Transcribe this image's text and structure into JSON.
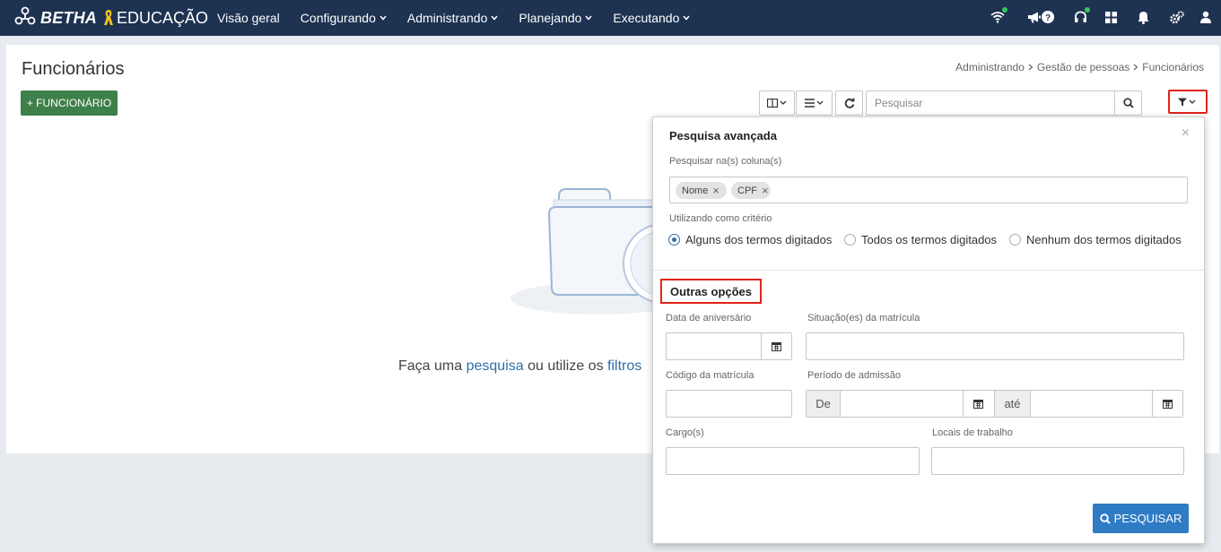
{
  "topbar": {
    "brand_name": "BETHA",
    "product_name": "EDUCAÇÃO",
    "nav": [
      {
        "label": "Visão geral"
      },
      {
        "label": "Configurando"
      },
      {
        "label": "Administrando"
      },
      {
        "label": "Planejando"
      },
      {
        "label": "Executando"
      }
    ],
    "icons": [
      "wifi-icon",
      "megaphone-icon",
      "help-icon",
      "headset-icon",
      "apps-grid-icon",
      "bell-icon",
      "settings-icon",
      "user-icon"
    ],
    "colors": {
      "background": "#1e3251",
      "status_dot": "#34c759"
    }
  },
  "page": {
    "title": "Funcionários",
    "breadcrumb": [
      "Administrando",
      "Gestão de pessoas",
      "Funcionários"
    ],
    "add_button": "+ FUNCIONÁRIO",
    "search_placeholder": "Pesquisar",
    "empty": {
      "prefix": "Faça uma ",
      "link1": "pesquisa",
      "middle": " ou utilize os ",
      "link2": "filtros"
    },
    "colors": {
      "add_button": "#3e8049",
      "link": "#2f6ea8",
      "highlight": "#e2231a"
    }
  },
  "advanced_search": {
    "title": "Pesquisa avançada",
    "columns_label": "Pesquisar na(s) coluna(s)",
    "columns": [
      {
        "label": "Nome"
      },
      {
        "label": "CPF"
      }
    ],
    "criteria_label": "Utilizando como critério",
    "criteria": [
      {
        "label": "Alguns dos termos digitados",
        "selected": true
      },
      {
        "label": "Todos os termos digitados",
        "selected": false
      },
      {
        "label": "Nenhum dos termos digitados",
        "selected": false
      }
    ],
    "other_options_title": "Outras opções",
    "fields": {
      "birthday": {
        "label": "Data de aniversário",
        "value": ""
      },
      "enrollment_status": {
        "label": "Situação(es) da matrícula",
        "value": ""
      },
      "enrollment_code": {
        "label": "Código da matrícula",
        "value": ""
      },
      "admission_period": {
        "label": "Período de admissão",
        "from_label": "De",
        "to_label": "até",
        "from_value": "",
        "to_value": ""
      },
      "positions": {
        "label": "Cargo(s)",
        "value": ""
      },
      "workplaces": {
        "label": "Locais de trabalho",
        "value": ""
      }
    },
    "submit_label": "PESQUISAR",
    "close_glyph": "×",
    "colors": {
      "submit": "#2f7bc4"
    }
  }
}
